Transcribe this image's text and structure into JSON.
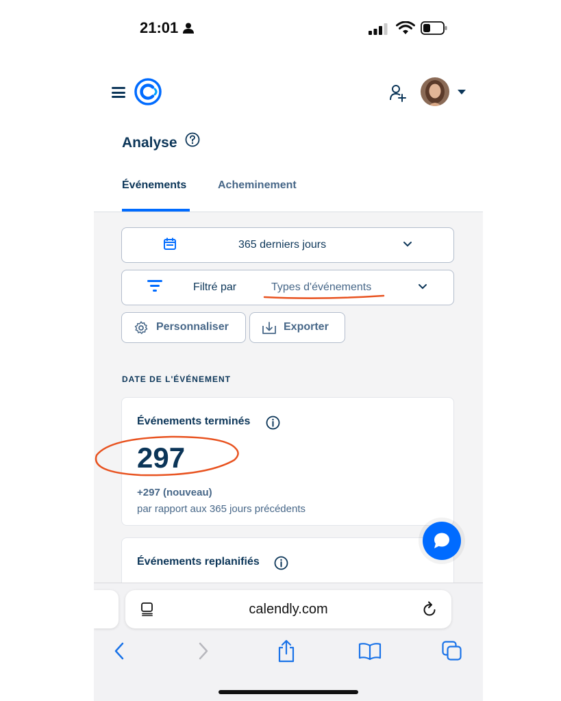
{
  "status_bar": {
    "time": "21:01"
  },
  "header": {
    "title": "Analyse"
  },
  "tabs": [
    {
      "label": "Événements",
      "active": true
    },
    {
      "label": "Acheminement",
      "active": false
    }
  ],
  "filters": {
    "date_range": "365 derniers jours",
    "filter_label": "Filtré par",
    "filter_value": "Types d'événements"
  },
  "actions": {
    "customize": "Personnaliser",
    "export": "Exporter"
  },
  "section_title": "DATE DE L'ÉVÉNEMENT",
  "cards": [
    {
      "title": "Événements terminés",
      "value": "297",
      "delta": "+297 (nouveau)",
      "compare": "par rapport aux 365 jours précédents"
    },
    {
      "title": "Événements replanifiés"
    }
  ],
  "browser": {
    "url": "calendly.com"
  },
  "colors": {
    "brand_blue": "#006bff",
    "navy": "#0b3558",
    "annotation": "#e8521f"
  }
}
